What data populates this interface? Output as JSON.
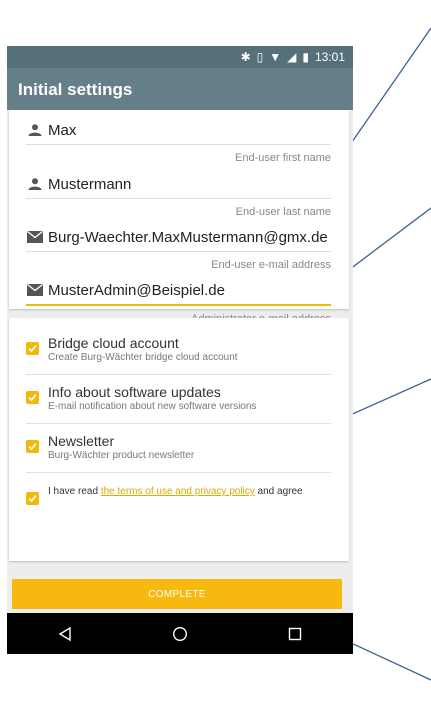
{
  "status_bar": {
    "time": "13:01",
    "icons": [
      "bluetooth-icon",
      "vibrate-icon",
      "wifi-icon",
      "signal-icon",
      "battery-icon"
    ]
  },
  "app_bar": {
    "title": "Initial settings"
  },
  "form": {
    "first_name": {
      "value": "Max",
      "hint": "End-user first name",
      "icon": "person-icon"
    },
    "last_name": {
      "value": "Mustermann",
      "hint": "End-user last name",
      "icon": "person-icon"
    },
    "user_email": {
      "value": "Burg-Waechter.MaxMustermann@gmx.de",
      "hint": "End-user e-mail address",
      "icon": "envelope-icon"
    },
    "admin_email": {
      "value": "MusterAdmin@Beispiel.de",
      "hint": "Administrator e-mail address",
      "icon": "envelope-icon"
    }
  },
  "options": [
    {
      "title": "Bridge cloud account",
      "subtitle": "Create Burg-Wächter bridge cloud account",
      "checked": true
    },
    {
      "title": "Info about software updates",
      "subtitle": "E-mail notification about new software versions",
      "checked": true
    },
    {
      "title": "Newsletter",
      "subtitle": "Burg-Wächter product newsletter",
      "checked": true
    }
  ],
  "terms": {
    "prefix": "I have read ",
    "link": "the terms of use and privacy policy",
    "suffix": " and agree",
    "checked": true
  },
  "complete_button": {
    "label": "COMPLETE"
  },
  "nav_bar": {
    "icons": [
      "back-icon",
      "home-icon",
      "recents-icon"
    ]
  },
  "colors": {
    "app_bar": "#647f88",
    "status_bar": "#56707a",
    "accent": "#f2b90c",
    "callout_line": "#3c6190"
  }
}
